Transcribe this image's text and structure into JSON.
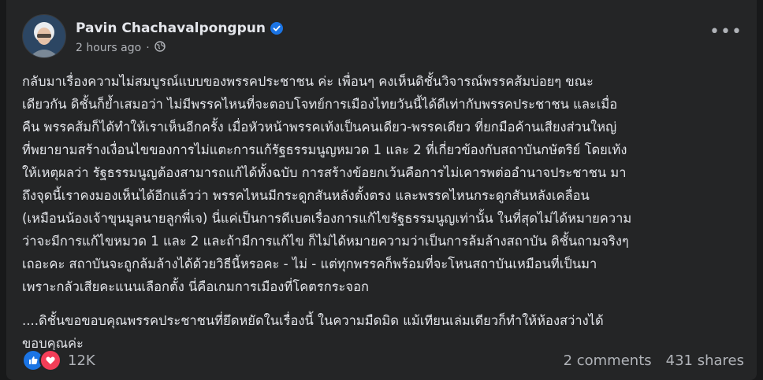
{
  "post": {
    "author": "Pavin Chachavalpongpun",
    "time": "2 hours ago",
    "dot": "·",
    "verified_icon": "verified-badge-icon",
    "privacy_icon": "globe-icon",
    "more_label": "•••",
    "paragraphs": [
      "กลับมาเรื่องความไม่สมบูรณ์แบบของพรรคประชาชน ค่ะ เพื่อนๆ คงเห็นดิชั้นวิจารณ์พรรคส้มบ่อยๆ ขณะ\nเดียวกัน ดิชั้นก็ย้ำเสมอว่า ไม่มีพรรคไหนที่จะตอบโจทย์การเมืองไทยวันนี้ได้ดีเท่ากับพรรคประชาชน และเมื่อ\nคืน พรรคส้มก็ได้ทำให้เราเห็นอีกครั้ง เมื่อหัวหน้าพรรคเท้งเป็นคนเดียว-พรรคเดียว ที่ยกมือค้านเสียงส่วนใหญ่\nที่พยายามสร้างเงื่อนไขของการไม่แตะการแก้รัฐธรรมนูญหมวด 1 และ 2 ที่เกี่ยวข้องกับสถาบันกษัตริย์ โดยเท้ง\nให้เหตุผลว่า รัฐธรรมนูญต้องสามารถแก้ได้ทั้งฉบับ การสร้างข้อยกเว้นคือการไม่เคารพต่ออำนาจประชาชน มา\nถึงจุดนี้เราคงมองเห็นได้อีกแล้วว่า พรรคไหนมีกระดูกสันหลังตั้งตรง และพรรคไหนกระดูกสันหลังเคลื่อน\n(เหมือนน้องเจ้าขุนมูลนายลูกพี่เจ) นี่แค่เป็นการดีเบตเรื่องการแก้ไขรัฐธรรมนูญเท่านั้น ในที่สุดไม่ได้หมายความ\nว่าจะมีการแก้ไขหมวด 1 และ 2 และถ้ามีการแก้ไข ก็ไม่ได้หมายความว่าเป็นการล้มล้างสถาบัน ดิชั้นถามจริงๆ\nเถอะคะ สถาบันจะถูกล้มล้างได้ด้วยวิธีนี้หรอคะ - ไม่ - แต่ทุกพรรคก็พร้อมที่จะโหนสถาบันเหมือนที่เป็นมา\nเพราะกลัวเสียคะแนนเลือกตั้ง นี่คือเกมการเมืองที่โคตรกระจอก",
      "....ดิชั้นขอขอบคุณพรรคประชาชนที่ยึดหยัดในเรื่องนี้ ในความมืดมิด แม้เทียนเล่มเดียวก็ทำให้ห้องสว่างได้\nขอบคุณค่ะ"
    ],
    "reaction_icons": [
      "like-icon",
      "love-icon"
    ],
    "reaction_count": "12K",
    "comments": "2 comments",
    "shares": "431 shares"
  },
  "colors": {
    "background": "#18191a",
    "card": "#242526",
    "text": "#e4e6eb",
    "secondary": "#b0b3b8",
    "like": "#1b74e4",
    "love": "#f33e58"
  }
}
